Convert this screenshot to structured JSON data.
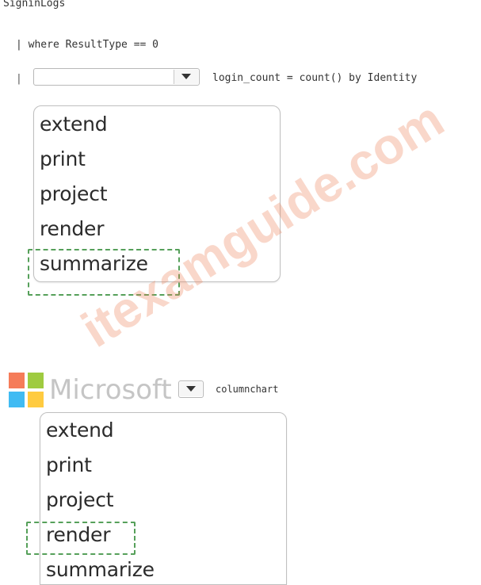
{
  "query": {
    "line1": "SigninLogs",
    "line2": "| where ResultType == 0",
    "pipe": "|",
    "line3_suffix": "login_count = count() by Identity",
    "line4_suffix": "columnchart"
  },
  "dropdown1": {
    "selected": "",
    "options": [
      "extend",
      "print",
      "project",
      "render",
      "summarize"
    ],
    "answer": "summarize"
  },
  "dropdown2": {
    "selected": "",
    "options": [
      "extend",
      "print",
      "project",
      "render",
      "summarize"
    ],
    "answer": "render"
  },
  "watermark": {
    "text": "itexamguide.com",
    "logo_text": "Microsoft"
  },
  "colors": {
    "answer_highlight": "#56a05a",
    "watermark": "#eb825a",
    "ms_red": "#f25022",
    "ms_green": "#7fba00",
    "ms_blue": "#00a4ef",
    "ms_yellow": "#ffb900"
  }
}
